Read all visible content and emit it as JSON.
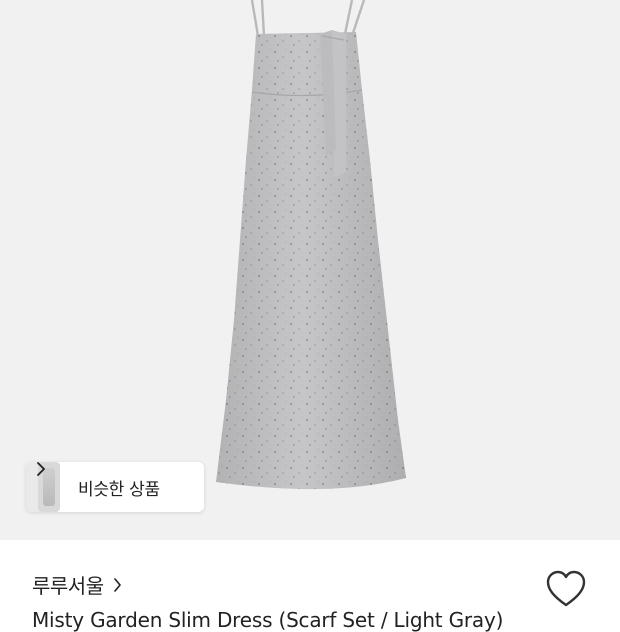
{
  "similar_products": {
    "label": "비슷한 상품"
  },
  "brand": {
    "name": "루루서울"
  },
  "product": {
    "title": "Misty Garden Slim Dress (Scarf Set / Light Gray)"
  },
  "icons": {
    "similar_chevron": "chevron-right-icon",
    "brand_chevron": "chevron-right-icon",
    "wishlist": "heart-outline-icon"
  },
  "colors": {
    "background": "#ffffff",
    "photo_bg": "#f1f1f1",
    "text": "#222222"
  }
}
